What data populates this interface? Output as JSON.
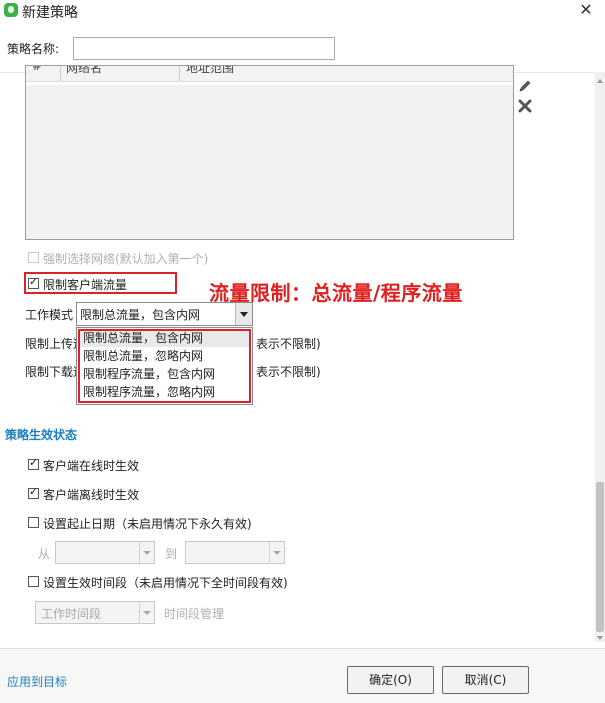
{
  "window": {
    "title": "新建策略",
    "close_glyph": "✕"
  },
  "policy_name": {
    "label": "策略名称:",
    "value": ""
  },
  "network_table": {
    "columns": [
      "#",
      "网络名",
      "地址范围"
    ],
    "rows": []
  },
  "icons": {
    "edit": "pencil-icon",
    "delete": "delete-x-icon",
    "app": "app-logo-icon"
  },
  "force_network": {
    "label": "强制选择网络(默认加入第一个)",
    "checked": false,
    "disabled": true
  },
  "limit_traffic": {
    "label": "限制客户端流量",
    "checked": true
  },
  "annotation": "流量限制：总流量/程序流量",
  "work_mode": {
    "label": "工作模式",
    "selected": "限制总流量，包含内网",
    "options": [
      "限制总流量，包含内网",
      "限制总流量，忽略内网",
      "限制程序流量，包含内网",
      "限制程序流量，忽略内网"
    ]
  },
  "upload_limit": {
    "label": "限制上传速",
    "suffix": "表示不限制)"
  },
  "download_limit": {
    "label": "限制下载速",
    "suffix": "表示不限制)"
  },
  "effect_section": {
    "title": "策略生效状态",
    "online": {
      "label": "客户端在线时生效",
      "checked": true
    },
    "offline": {
      "label": "客户端离线时生效",
      "checked": true
    },
    "date_range": {
      "label": "设置起止日期（未启用情况下永久有效)",
      "checked": false
    },
    "from_label": "从",
    "to_label": "到",
    "time_period": {
      "label": "设置生效时间段（未启用情况下全时间段有效)",
      "checked": false
    },
    "period_value": "工作时间段",
    "period_manage": "时间段管理"
  },
  "footer": {
    "apply_link": "应用到目标",
    "ok_label": "确定(O)",
    "cancel_label": "取消(C)"
  },
  "colors": {
    "annotation_red": "#e02020",
    "accent_blue": "#1c7fbf"
  }
}
